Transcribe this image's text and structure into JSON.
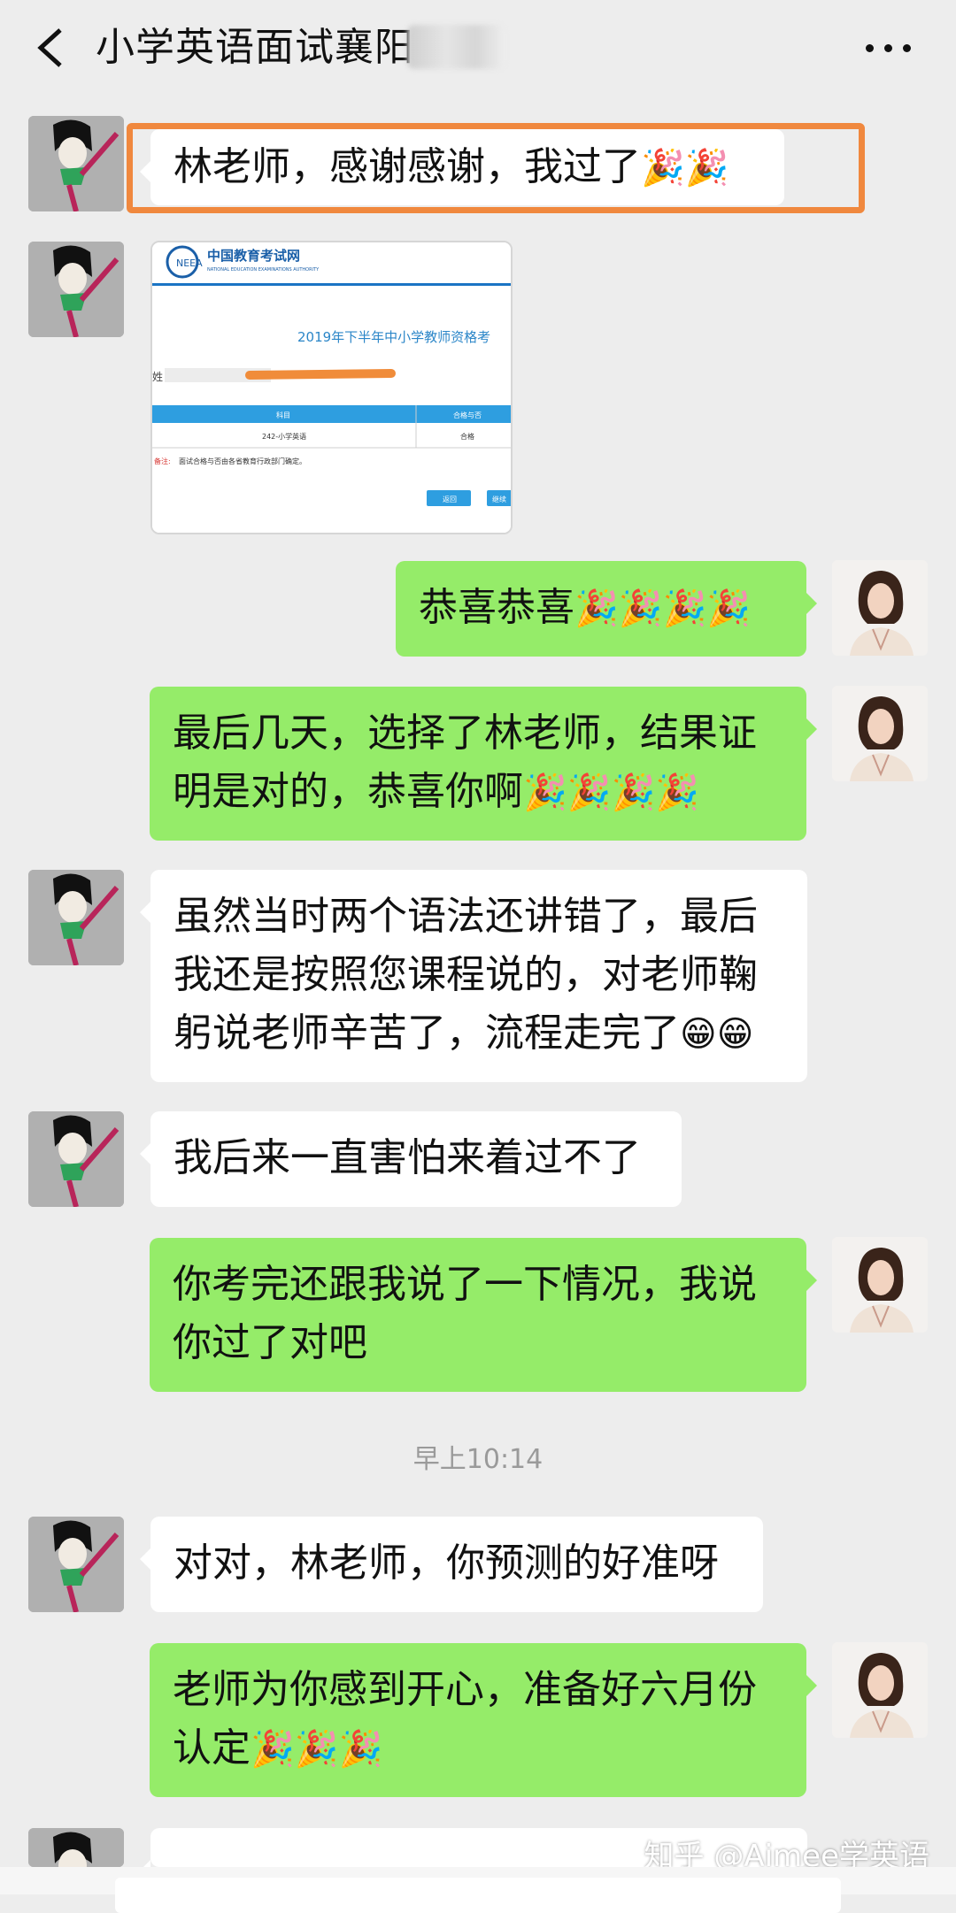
{
  "header": {
    "title": "小学英语面试襄阳"
  },
  "image_card": {
    "site_name": "中国教育考试网",
    "site_name_en": "NATIONAL EDUCATION EXAMINATIONS AUTHORITY",
    "heading": "2019年下半年中小学教师资格考",
    "name_label": "姓",
    "col_subject": "科目",
    "col_result": "合格与否",
    "row_subject": "242-小学英语",
    "row_result": "合格",
    "note_label": "备注:",
    "note_text": "面试合格与否由各省教育行政部门确定。",
    "btn_back": "返回",
    "btn_continue": "继续"
  },
  "messages": {
    "m1": "林老师，感谢感谢，我过了",
    "m1_emoji": "🎉🎉",
    "m3": "恭喜恭喜",
    "m3_emoji": "🎉🎉🎉🎉",
    "m4": "最后几天，选择了林老师，结果证明是对的，恭喜你啊",
    "m4_emoji": "🎉🎉🎉🎉",
    "m5": "虽然当时两个语法还讲错了，最后我还是按照您课程说的，对老师鞠躬说老师辛苦了，流程走完了",
    "m5_emoji": "😁😁",
    "m6": "我后来一直害怕来着过不了",
    "m7": "你考完还跟我说了一下情况，我说你过了对吧",
    "time": "早上10:14",
    "m8": "对对，林老师，你预测的好准呀",
    "m9": "老师为你感到开心，准备好六月份认定",
    "m9_emoji": "🎉🎉🎉"
  },
  "watermark": "知乎 @Aimee学英语",
  "colors": {
    "background": "#ededed",
    "bubble_sent": "#95ec69",
    "bubble_received": "#ffffff",
    "highlight": "#f0883e"
  }
}
